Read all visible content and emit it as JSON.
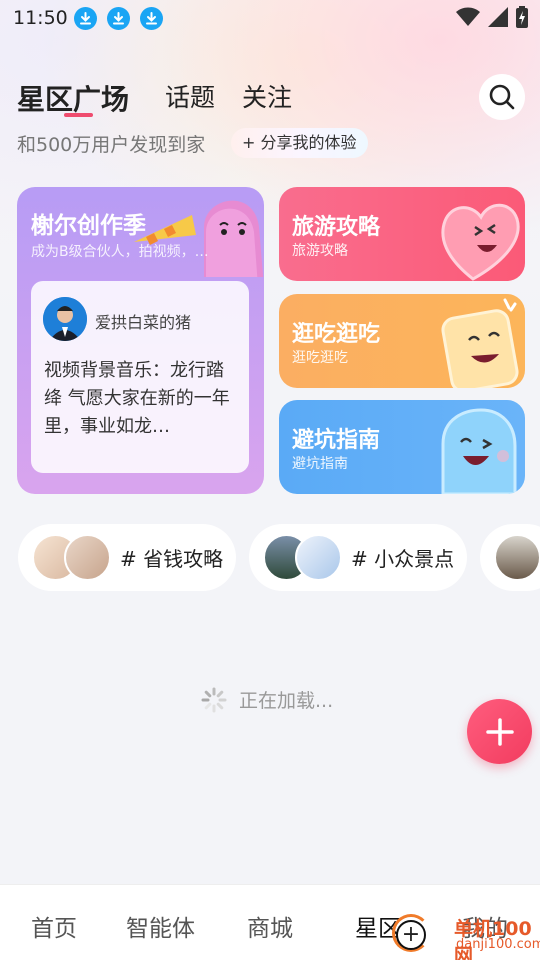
{
  "status_bar": {
    "time": "11:50",
    "download_icons": [
      "download-icon",
      "download-icon",
      "download-icon"
    ],
    "system_icons": [
      "wifi-icon",
      "signal-icon",
      "battery-charging-icon"
    ]
  },
  "header": {
    "tabs": [
      {
        "label": "星区广场",
        "active": true
      },
      {
        "label": "话题",
        "active": false
      },
      {
        "label": "关注",
        "active": false
      }
    ],
    "search_icon": "search-icon",
    "subtitle": "和500万用户发现到家",
    "share_label": "+ 分享我的体验"
  },
  "colors": {
    "accent": "#ef4c6f",
    "big_card": "#c6a0f2",
    "travel": "#fa6382",
    "food": "#fbb05e",
    "pit": "#5fb0f7"
  },
  "featured": {
    "title": "榭尔创作季",
    "subtitle": "成为B级合伙人，拍视频，…",
    "post": {
      "author": "爱拱白菜的猪",
      "text": "视频背景音乐：龙行踏绛 气愿大家在新的一年里，事业如龙…"
    }
  },
  "categories": [
    {
      "title": "旅游攻略",
      "subtitle": "旅游攻略",
      "mascot": "heart-mascot-icon"
    },
    {
      "title": "逛吃逛吃",
      "subtitle": "逛吃逛吃",
      "mascot": "bread-mascot-icon"
    },
    {
      "title": "避坑指南",
      "subtitle": "避坑指南",
      "mascot": "ghost-mascot-icon"
    }
  ],
  "topics": [
    {
      "label": "# 省钱攻略"
    },
    {
      "label": "# 小众景点"
    },
    {
      "label": ""
    }
  ],
  "loading_text": "正在加载...",
  "fab_icon": "plus-icon",
  "bottom_nav": [
    {
      "label": "首页"
    },
    {
      "label": "智能体"
    },
    {
      "label": "商城"
    },
    {
      "label": "星区"
    },
    {
      "label": "我的"
    }
  ],
  "watermark": {
    "brand": "单机100网",
    "url": "danji100.com"
  }
}
